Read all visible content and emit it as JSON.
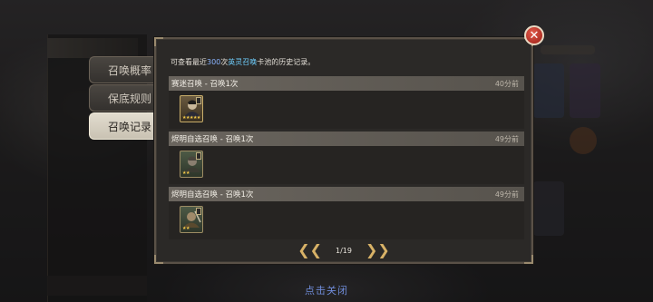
{
  "tabs": [
    {
      "label": "召唤概率"
    },
    {
      "label": "保底规则"
    },
    {
      "label": "召唤记录"
    }
  ],
  "note": {
    "prefix": "可查看最近",
    "count": "300",
    "mid": "次",
    "pool_link": "英灵召唤",
    "suffix": "卡池的历史记录。"
  },
  "records": [
    {
      "title": "赛迷召唤 - 召唤1次",
      "time": "40分前",
      "card": {
        "stars": "★★★★★",
        "style": "gold"
      }
    },
    {
      "title": "烬明自选召唤 - 召唤1次",
      "time": "49分前",
      "card": {
        "stars": "★★",
        "style": "green"
      }
    },
    {
      "title": "烬明自选召唤 - 召唤1次",
      "time": "49分前",
      "card": {
        "stars": "★★",
        "style": "green"
      }
    }
  ],
  "pager": {
    "current": "1/19",
    "prev_icon": "double-chevron-left",
    "next_icon": "double-chevron-right"
  },
  "close_icon": "close-x",
  "footer_hint": "点击关闭",
  "colors": {
    "accent_blue": "#8ab4ff",
    "link": "#6fd0ff",
    "gold": "#d8b267",
    "close": "#c0392b"
  }
}
